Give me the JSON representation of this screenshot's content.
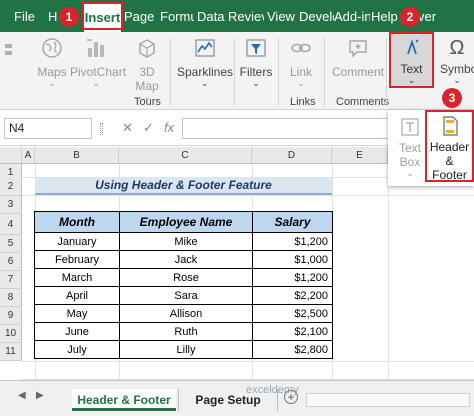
{
  "ribbon_tabs": [
    {
      "label": "File"
    },
    {
      "label": "H"
    },
    {
      "label": "Insert"
    },
    {
      "label": "Page L"
    },
    {
      "label": "Formu"
    },
    {
      "label": "Data"
    },
    {
      "label": "Reviev"
    },
    {
      "label": "View"
    },
    {
      "label": "Develo"
    },
    {
      "label": "Add-in"
    },
    {
      "label": "Help"
    },
    {
      "label": "ver"
    }
  ],
  "badges": {
    "one": "1",
    "two": "2",
    "three": "3"
  },
  "ribbon": {
    "maps": "Maps",
    "pivotchart": "PivotChart",
    "map3d_line1": "3D",
    "map3d_line2": "Map",
    "sparklines": "Sparklines",
    "filters": "Filters",
    "link": "Link",
    "comment": "Comment",
    "text": "Text",
    "symbols": "Symbo",
    "group_tours": "Tours",
    "group_links": "Links",
    "group_comments": "Comments"
  },
  "dropdown": {
    "textbox_line1": "Text",
    "textbox_line2": "Box",
    "header_line1": "Header",
    "header_line2": "& Footer"
  },
  "formula_bar": {
    "name_box": "N4",
    "fx": "fx"
  },
  "columns": [
    "A",
    "B",
    "C",
    "D",
    "E"
  ],
  "rows": [
    "1",
    "2",
    "3",
    "4",
    "5",
    "6",
    "7",
    "8",
    "9",
    "10",
    "11"
  ],
  "sheet": {
    "title": "Using Header & Footer Feature",
    "headers": [
      "Month",
      "Employee Name",
      "Salary"
    ],
    "rows": [
      {
        "month": "January",
        "name": "Mike",
        "salary": "$1,200"
      },
      {
        "month": "February",
        "name": "Jack",
        "salary": "$1,000"
      },
      {
        "month": "March",
        "name": "Rose",
        "salary": "$1,200"
      },
      {
        "month": "April",
        "name": "Sara",
        "salary": "$2,200"
      },
      {
        "month": "May",
        "name": "Allison",
        "salary": "$2,500"
      },
      {
        "month": "June",
        "name": "Ruth",
        "salary": "$2,100"
      },
      {
        "month": "July",
        "name": "Lilly",
        "salary": "$2,800"
      }
    ]
  },
  "sheet_tabs": {
    "active": "Header & Footer",
    "other": "Page Setup",
    "watermark": "exceldemy"
  },
  "colors": {
    "excel_green": "#217346",
    "highlight_red": "#d9242b",
    "header_fill": "#bdd7ee",
    "title_fill": "#dce6f1"
  }
}
